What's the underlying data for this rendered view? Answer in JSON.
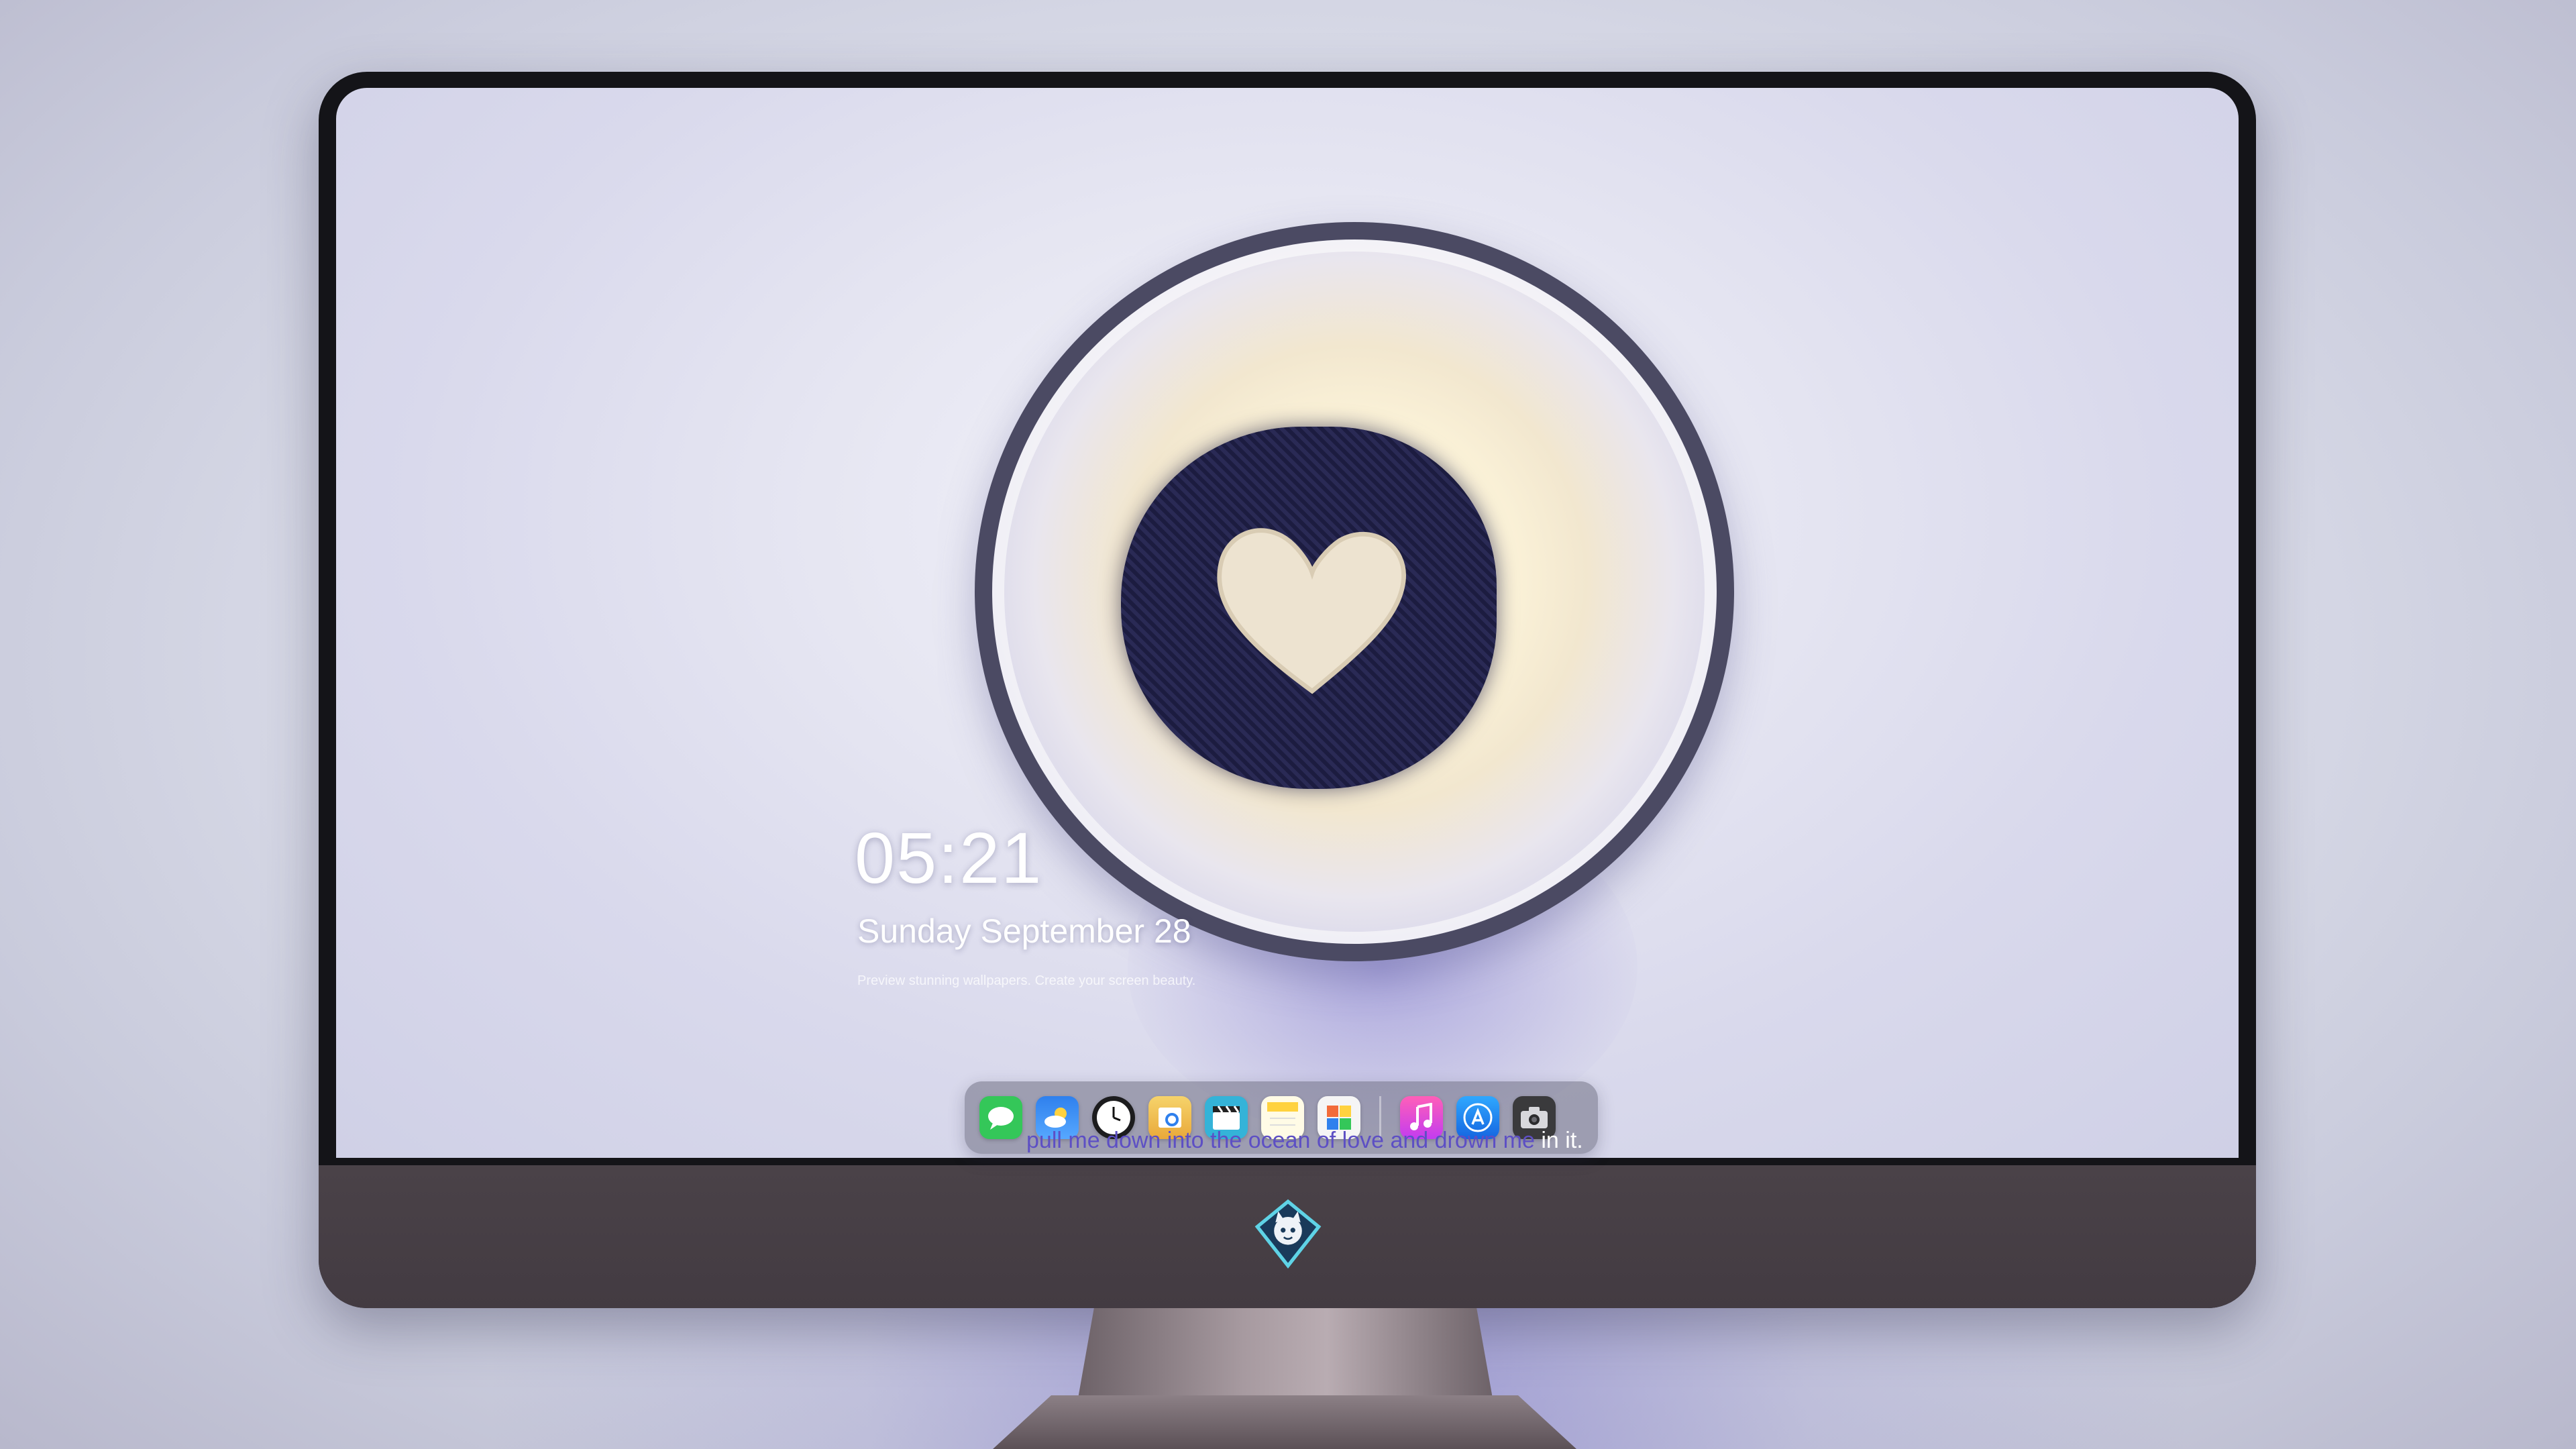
{
  "lockscreen": {
    "time": "05:21",
    "date": "Sunday September  28",
    "subtitle": "Preview stunning wallpapers. Create your screen beauty."
  },
  "wallpaper": {
    "description_icon": "milk-glass-heart-wallpaper",
    "signature_icon": "signature-watermark"
  },
  "lyric": {
    "sung": "pull me down into the ocean of love and drown me",
    "remaining": " in it."
  },
  "dock": {
    "apps": [
      {
        "icon": "messages-icon",
        "color": "#34c759"
      },
      {
        "icon": "weather-icon",
        "color": "#2f80ed"
      },
      {
        "icon": "clock-icon",
        "color": "#1c1c1e"
      },
      {
        "icon": "preview-icon",
        "color": "#e9b949"
      },
      {
        "icon": "video-icon",
        "color": "#34b3d8"
      },
      {
        "icon": "notes-icon",
        "color": "#ffd23f"
      },
      {
        "icon": "photos-icon",
        "color": "#f5f5f5"
      },
      {
        "icon": "music-icon",
        "color": "#ff3fa4"
      },
      {
        "icon": "app-store-icon",
        "color": "#1e88f7"
      },
      {
        "icon": "camera-icon",
        "color": "#2c2c2e"
      }
    ]
  },
  "monitor": {
    "logo_icon": "cat-diamond-logo-icon"
  }
}
